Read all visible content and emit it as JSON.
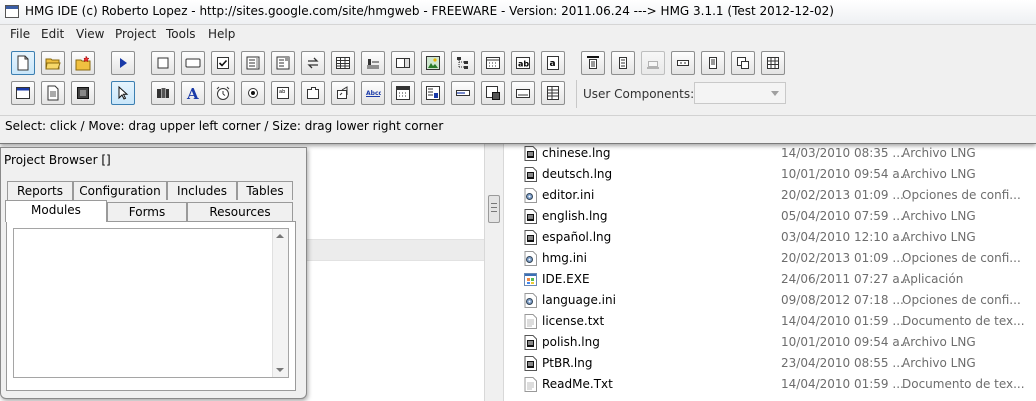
{
  "window": {
    "title": "HMG IDE (c) Roberto Lopez - http://sites.google.com/site/hmgweb - FREEWARE - Version: 2011.06.24 ---> HMG 3.1.1 (Test 2012-12-02)"
  },
  "menu": [
    "File",
    "Edit",
    "View",
    "Project",
    "Tools",
    "Help"
  ],
  "toolbar": {
    "user_components_label": "User Components:",
    "user_components_value": ""
  },
  "status": {
    "text": "Select: click / Move: drag upper left corner / Size: drag lower right corner"
  },
  "project_browser": {
    "title": "Project Browser []",
    "tabs_row1": [
      "Reports",
      "Configuration",
      "Includes",
      "Tables"
    ],
    "tabs_row2": [
      "Modules",
      "Forms",
      "Resources"
    ],
    "active_tab": "Modules"
  },
  "files": [
    {
      "name": "chinese.lng",
      "date": "14/03/2010 08:35 ...",
      "type": "Archivo LNG",
      "icon": "lng-file-icon"
    },
    {
      "name": "deutsch.lng",
      "date": "10/01/2010 09:54 a...",
      "type": "Archivo LNG",
      "icon": "lng-file-icon"
    },
    {
      "name": "editor.ini",
      "date": "20/02/2013 01:09 ...",
      "type": "Opciones de confi...",
      "icon": "ini-file-icon"
    },
    {
      "name": "english.lng",
      "date": "05/04/2010 07:59 ...",
      "type": "Archivo LNG",
      "icon": "lng-file-icon"
    },
    {
      "name": "español.lng",
      "date": "03/04/2010 12:10 a...",
      "type": "Archivo LNG",
      "icon": "lng-file-icon"
    },
    {
      "name": "hmg.ini",
      "date": "20/02/2013 01:09 ...",
      "type": "Opciones de confi...",
      "icon": "ini-file-icon"
    },
    {
      "name": "IDE.EXE",
      "date": "24/06/2011 07:27 a...",
      "type": "Aplicación",
      "icon": "exe-file-icon"
    },
    {
      "name": "language.ini",
      "date": "09/08/2012 07:18 ...",
      "type": "Opciones de confi...",
      "icon": "ini-file-icon"
    },
    {
      "name": "license.txt",
      "date": "14/04/2010 01:59 ...",
      "type": "Documento de tex...",
      "icon": "txt-file-icon"
    },
    {
      "name": "polish.lng",
      "date": "10/01/2010 09:54 a...",
      "type": "Archivo LNG",
      "icon": "lng-file-icon"
    },
    {
      "name": "PtBR.lng",
      "date": "23/04/2010 08:55 ...",
      "type": "Archivo LNG",
      "icon": "lng-file-icon"
    },
    {
      "name": "ReadMe.Txt",
      "date": "14/04/2010 01:59 ...",
      "type": "Documento de tex...",
      "icon": "txt-file-icon"
    }
  ]
}
